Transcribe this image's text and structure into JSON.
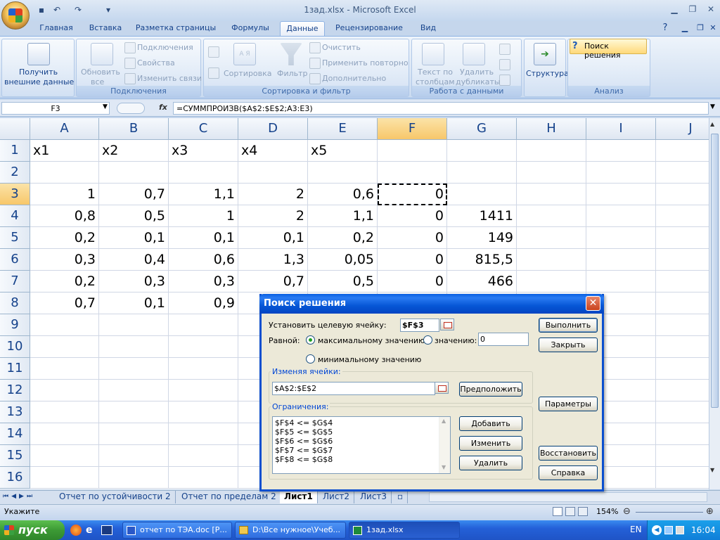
{
  "window": {
    "title": "1зад.xlsx - Microsoft Excel"
  },
  "ribbon_tabs": [
    "Главная",
    "Вставка",
    "Разметка страницы",
    "Формулы",
    "Данные",
    "Рецензирование",
    "Вид"
  ],
  "active_tab": "Данные",
  "ribbon": {
    "get_external": {
      "line1": "Получить",
      "line2": "внешние данные"
    },
    "refresh": {
      "line1": "Обновить",
      "line2": "все"
    },
    "connections": "Подключения",
    "properties": "Свойства",
    "edit_links": "Изменить связи",
    "group_connections": "Подключения",
    "sort": "Сортировка",
    "filter": "Фильтр",
    "clear": "Очистить",
    "reapply": "Применить повторно",
    "advanced": "Дополнительно",
    "sort_az": "А Я",
    "group_sort": "Сортировка и фильтр",
    "text_to_cols": {
      "line1": "Текст по",
      "line2": "столбцам"
    },
    "remove_dup": {
      "line1": "Удалить",
      "line2": "дубликаты"
    },
    "group_data": "Работа с данными",
    "outline": "Структура",
    "solver": "Поиск решения",
    "group_analysis": "Анализ"
  },
  "formula_bar": {
    "name_box": "F3",
    "fx": "fx",
    "formula": "=СУММПРОИЗВ($A$2:$E$2;A3:E3)"
  },
  "columns": [
    "A",
    "B",
    "C",
    "D",
    "E",
    "F",
    "G",
    "H",
    "I",
    "J"
  ],
  "rows": [
    "1",
    "2",
    "3",
    "4",
    "5",
    "6",
    "7",
    "8",
    "9",
    "10",
    "11",
    "12",
    "13",
    "14",
    "15",
    "16"
  ],
  "cells": {
    "r1": [
      "x1",
      "x2",
      "x3",
      "x4",
      "x5"
    ],
    "r3": [
      "1",
      "0,7",
      "1,1",
      "2",
      "0,6",
      "0"
    ],
    "r4": [
      "0,8",
      "0,5",
      "1",
      "2",
      "1,1",
      "0",
      "1411"
    ],
    "r5": [
      "0,2",
      "0,1",
      "0,1",
      "0,1",
      "0,2",
      "0",
      "149"
    ],
    "r6": [
      "0,3",
      "0,4",
      "0,6",
      "1,3",
      "0,05",
      "0",
      "815,5"
    ],
    "r7": [
      "0,2",
      "0,3",
      "0,3",
      "0,7",
      "0,5",
      "0",
      "466"
    ],
    "r8": [
      "0,7",
      "0,1",
      "0,9"
    ]
  },
  "sheet_tabs": [
    "Отчет по устойчивости 2",
    "Отчет по пределам 2",
    "Лист1",
    "Лист2",
    "Лист3"
  ],
  "active_sheet": "Лист1",
  "status": {
    "mode": "Укажите",
    "zoom": "154%"
  },
  "dialog": {
    "title": "Поиск решения",
    "target_label": "Установить целевую ячейку:",
    "target_value": "$F$3",
    "equal_label": "Равной:",
    "opt_max": "максимальному значению",
    "opt_value": "значению:",
    "value_input": "0",
    "opt_min": "минимальному значению",
    "changing_label": "Изменяя ячейки:",
    "changing_value": "$A$2:$E$2",
    "constraints_label": "Ограничения:",
    "constraints": [
      "$F$4 <= $G$4",
      "$F$5 <= $G$5",
      "$F$6 <= $G$6",
      "$F$7 <= $G$7",
      "$F$8 <= $G$8"
    ],
    "btn_solve": "Выполнить",
    "btn_close": "Закрыть",
    "btn_guess": "Предположить",
    "btn_options": "Параметры",
    "btn_add": "Добавить",
    "btn_change": "Изменить",
    "btn_delete": "Удалить",
    "btn_reset": "Восстановить",
    "btn_help": "Справка",
    "selected_option": "max"
  },
  "taskbar": {
    "start": "пуск",
    "tasks": [
      "отчет по ТЭА.doc [Р...",
      "D:\\Все нужное\\Учеб...",
      "1зад.xlsx"
    ],
    "active_task": "1зад.xlsx",
    "lang": "EN",
    "time": "16:04"
  }
}
